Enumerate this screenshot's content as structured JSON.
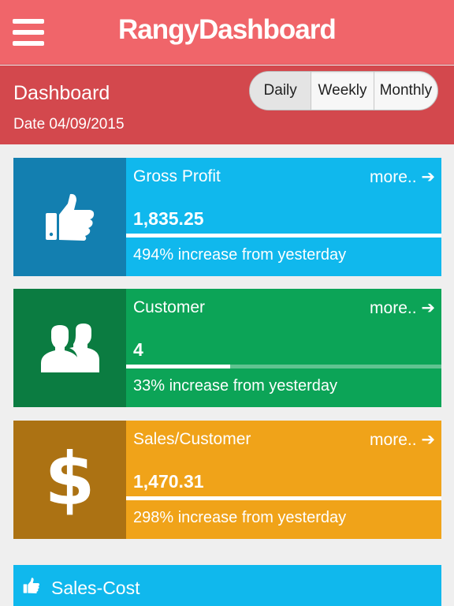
{
  "header": {
    "app_title": "RangyDashboard",
    "menu_icon": "hamburger-menu-icon"
  },
  "subheader": {
    "title": "Dashboard",
    "date": "Date 04/09/2015",
    "periods": [
      "Daily",
      "Weekly",
      "Monthly"
    ],
    "selected_period": "Daily"
  },
  "cards": [
    {
      "icon": "thumbs-up-icon",
      "label": "Gross Profit",
      "more": "more.. ➔",
      "value": "1,835.25",
      "progress_fraction": 1.0,
      "description": "494% increase from yesterday",
      "icon_bg": "#137fb0",
      "body_bg": "#10b8ed"
    },
    {
      "icon": "users-icon",
      "label": "Customer",
      "more": "more.. ➔",
      "value": "4",
      "progress_fraction": 0.33,
      "description": "33% increase from yesterday",
      "icon_bg": "#0b7c41",
      "body_bg": "#0ca457"
    },
    {
      "icon": "dollar-icon",
      "icon_glyph": "$",
      "label": "Sales/Customer",
      "more": "more.. ➔",
      "value": "1,470.31",
      "progress_fraction": 1.0,
      "description": "298% increase from yesterday",
      "icon_bg": "#ac7213",
      "body_bg": "#f0a319"
    }
  ],
  "panel": {
    "icon": "thumbs-up-icon",
    "title": "Sales-Cost"
  },
  "colors": {
    "topbar": "#f0656a",
    "subheader": "#d3484d",
    "page_bg": "#efefef"
  }
}
